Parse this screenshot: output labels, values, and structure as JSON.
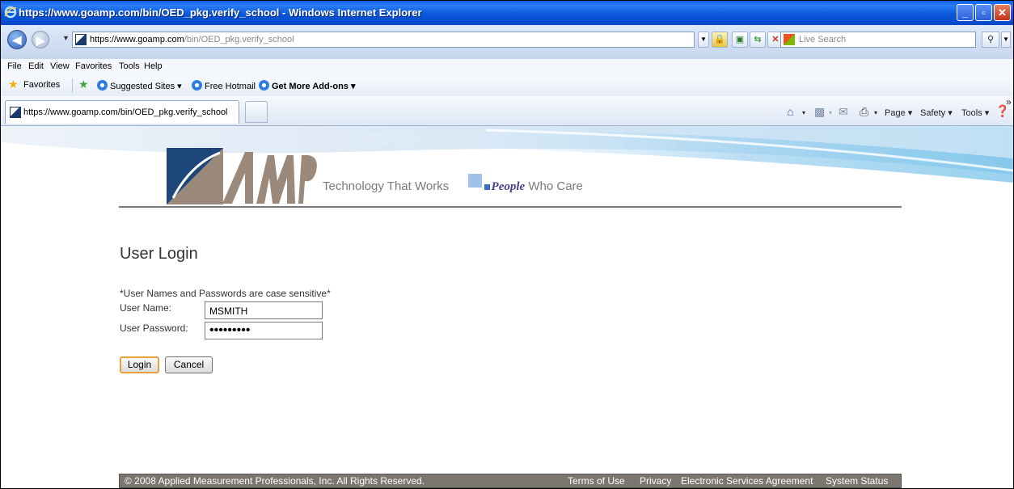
{
  "window": {
    "title": "https://www.goamp.com/bin/OED_pkg.verify_school - Windows Internet Explorer",
    "min_glyph": "_",
    "max_glyph": "▫",
    "close_glyph": "✕"
  },
  "address_bar": {
    "url_host": "https://www.goamp.com",
    "url_path": "/bin/OED_pkg.verify_school",
    "search_placeholder": "Live Search"
  },
  "menu": [
    "File",
    "Edit",
    "View",
    "Favorites",
    "Tools",
    "Help"
  ],
  "favorites_bar": {
    "favorites_label": "Favorites",
    "links": [
      "Suggested Sites ▾",
      "Free Hotmail",
      "Get More Add-ons ▾"
    ]
  },
  "tab": {
    "title": "https://www.goamp.com/bin/OED_pkg.verify_school"
  },
  "command_bar": {
    "page": "Page ▾",
    "safety": "Safety ▾",
    "tools": "Tools ▾",
    "more": "»"
  },
  "header": {
    "tagline_tech": "Technology That Works",
    "tagline_people": "People",
    "tagline_care": "Who Care"
  },
  "login": {
    "title": "User Login",
    "note": "*User Names and Passwords are case sensitive*",
    "username_label": "User Name:",
    "username_value": "MSMITH",
    "password_label": "User Password:",
    "password_value": "•••••••••",
    "login_button": "Login",
    "cancel_button": "Cancel"
  },
  "footer": {
    "copyright": "© 2008 Applied Measurement Professionals, Inc. All Rights Reserved.",
    "links": [
      "Terms of Use",
      "Privacy",
      "Electronic Services Agreement",
      "System Status"
    ]
  },
  "colors": {
    "titlebar": "#0b58dd",
    "footer_bg": "#7c7670",
    "people_text": "#4c3f8a",
    "focus_border": "#e8a23a"
  },
  "icons": [
    "ie-logo-icon",
    "back-icon",
    "forward-icon",
    "lock-icon",
    "refresh-icon",
    "stop-icon",
    "search-icon",
    "star-icon",
    "home-icon",
    "feeds-icon",
    "mail-icon",
    "print-icon",
    "help-icon"
  ]
}
